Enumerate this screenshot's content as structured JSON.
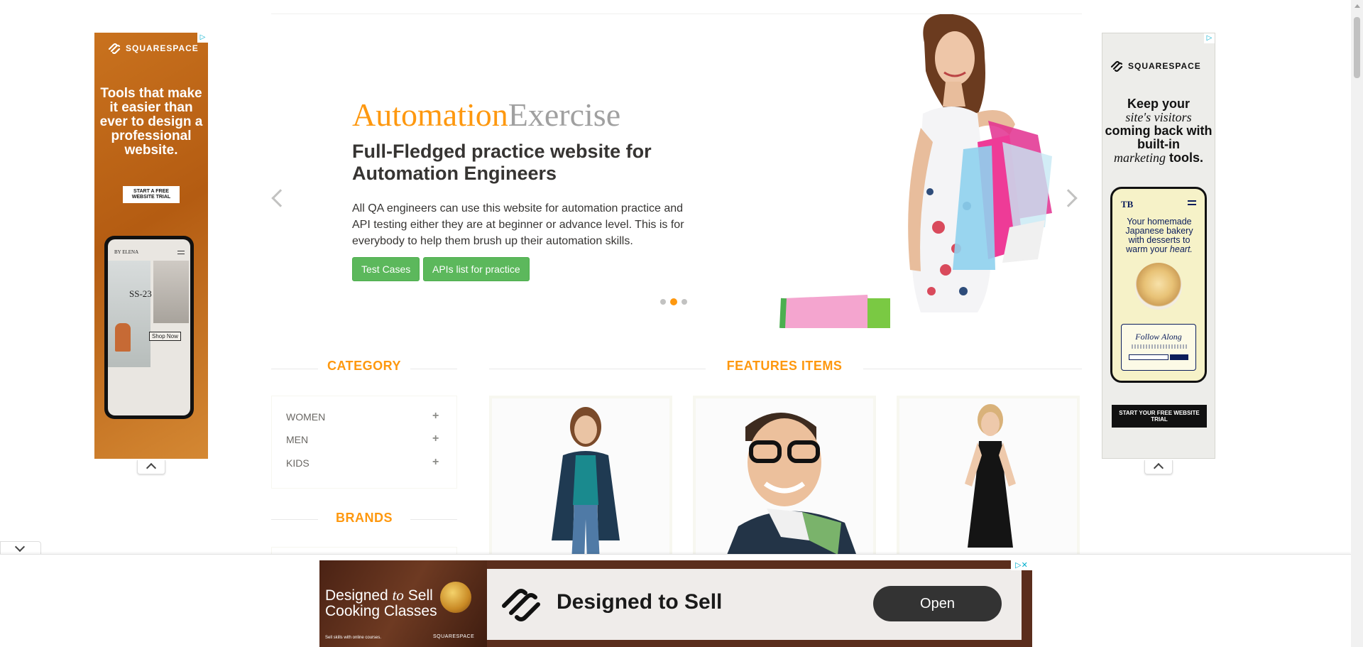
{
  "hero": {
    "title_automation": "Automation",
    "title_exercise": "Exercise",
    "heading": "Full-Fledged practice website for Automation Engineers",
    "description": "All QA engineers can use this website for automation practice and API testing either they are at beginner or advance level. This is for everybody to help them brush up their automation skills.",
    "btn_test_cases": "Test Cases",
    "btn_apis": "APIs list for practice",
    "slide_count": 3,
    "active_slide": 2
  },
  "category": {
    "title": "CATEGORY",
    "items": [
      {
        "label": "WOMEN",
        "icon": "plus-icon"
      },
      {
        "label": "MEN",
        "icon": "plus-icon"
      },
      {
        "label": "KIDS",
        "icon": "plus-icon"
      }
    ]
  },
  "brands": {
    "title": "BRANDS"
  },
  "features": {
    "title": "FEATURES ITEMS"
  },
  "ads": {
    "left": {
      "brand": "SQUARESPACE",
      "headline": "Tools that make it easier than ever to design a professional website.",
      "cta": "START A FREE WEBSITE TRIAL",
      "phone_brand": "BY ELENA",
      "phone_ss": "SS-23",
      "phone_shop": "Shop Now"
    },
    "right": {
      "brand": "SQUARESPACE",
      "headline_1": "Keep your",
      "headline_2": "site's visitors",
      "headline_3": "coming back with built-in",
      "headline_4": "marketing",
      "headline_5": "tools.",
      "phone_logo": "TB",
      "phone_text_1": "Your homemade Japanese bakery with desserts to warm your",
      "phone_text_2": "heart.",
      "follow": "Follow Along",
      "cta": "START YOUR FREE WEBSITE TRIAL"
    },
    "bottom": {
      "left_text_1": "Designed",
      "left_text_2": "to",
      "left_text_3": "Sell",
      "left_text_4": "Cooking Classes",
      "left_small": "Sell skills with online courses.",
      "left_brand": "SQUARESPACE",
      "headline": "Designed to Sell",
      "open": "Open"
    }
  },
  "colors": {
    "accent": "#fe980f",
    "button_green": "#5cb85c",
    "heading_dark": "#363432"
  }
}
